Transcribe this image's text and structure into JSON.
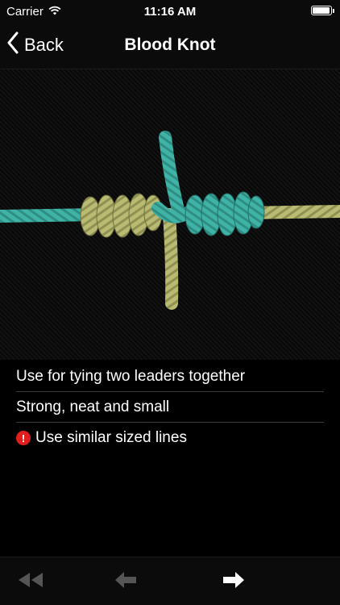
{
  "status_bar": {
    "carrier": "Carrier",
    "time": "11:16 AM",
    "battery_level": 0.95,
    "icons": [
      "wifi-icon",
      "battery-icon"
    ]
  },
  "nav": {
    "back_label": "Back",
    "title": "Blood Knot",
    "back_icon": "chevron-left-icon"
  },
  "knot_image": {
    "subject": "blood-knot-rope-illustration",
    "colors": {
      "teal_rope": "#3fb3a6",
      "olive_rope": "#b9bb73",
      "background": "#0a0a0a"
    }
  },
  "info": [
    {
      "text": "Use for tying two leaders together",
      "icon": null
    },
    {
      "text": "Strong, neat and small",
      "icon": null
    },
    {
      "text": "Use similar sized lines",
      "icon": "warning-icon",
      "icon_glyph": "!"
    }
  ],
  "toolbar": {
    "first_icon": "rewind-icon",
    "prev_icon": "arrow-left-icon",
    "next_icon": "arrow-right-icon",
    "disabled_color": "#555555",
    "enabled_color": "#ffffff"
  },
  "colors": {
    "warning": "#e01e1e",
    "bar_background": "#0b0b0b"
  }
}
